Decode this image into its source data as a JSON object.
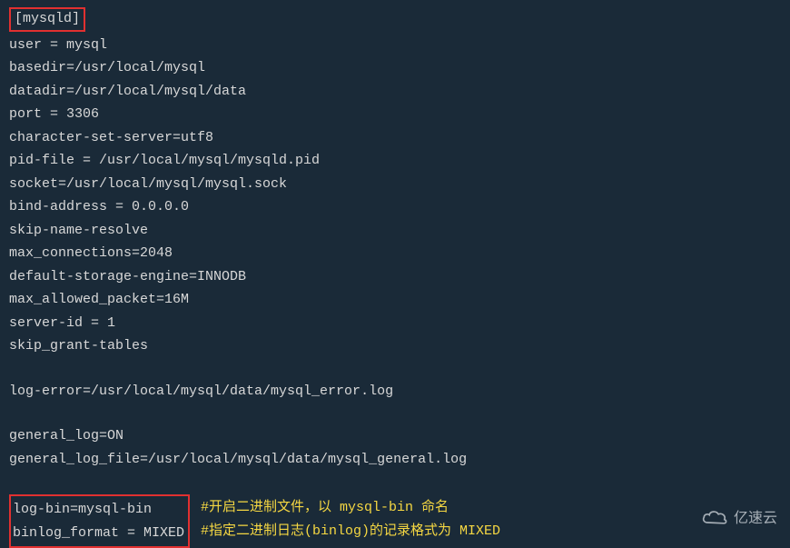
{
  "config": {
    "section_header": "[mysqld]",
    "lines": [
      "user = mysql",
      "basedir=/usr/local/mysql",
      "datadir=/usr/local/mysql/data",
      "port = 3306",
      "character-set-server=utf8",
      "pid-file = /usr/local/mysql/mysqld.pid",
      "socket=/usr/local/mysql/mysql.sock",
      "bind-address = 0.0.0.0",
      "skip-name-resolve",
      "max_connections=2048",
      "default-storage-engine=INNODB",
      "max_allowed_packet=16M",
      "server-id = 1",
      "skip_grant-tables"
    ],
    "log_error_line": "log-error=/usr/local/mysql/data/mysql_error.log",
    "general_log_lines": [
      "general_log=ON",
      "general_log_file=/usr/local/mysql/data/mysql_general.log"
    ],
    "binlog_lines": [
      "log-bin=mysql-bin",
      "binlog_format = MIXED"
    ],
    "comments": [
      "#开启二进制文件，以 mysql-bin 命名",
      "#指定二进制日志(binlog)的记录格式为 MIXED"
    ]
  },
  "watermark": {
    "text": "亿速云"
  }
}
